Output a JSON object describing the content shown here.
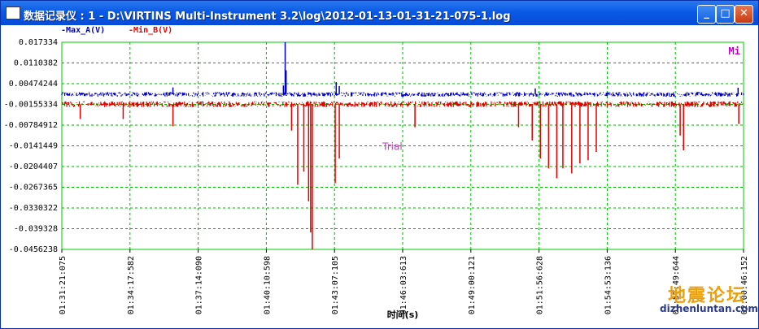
{
  "window": {
    "title": "数据记录仪 : 1 - D:\\VIRTINS Multi-Instrument 3.2\\log\\2012-01-13-01-31-21-075-1.log",
    "minimize_icon": "minimize-icon",
    "maximize_icon": "maximize-icon",
    "close_icon": "close-icon"
  },
  "chart_data": {
    "type": "line",
    "xlabel": "时间(s)",
    "ylabel": "",
    "title": "",
    "grid": true,
    "legend_position": "top-left",
    "watermark": "Trial",
    "corner_marker": "Mi",
    "yticks": [
      "0.017334",
      "0.0110382",
      "0.00474244",
      "-0.00155334",
      "-0.00784912",
      "-0.0141449",
      "-0.0204407",
      "-0.0267365",
      "-0.0330322",
      "-0.039328",
      "-0.0456238"
    ],
    "xticks": [
      "01:31:21:075",
      "01:34:17:582",
      "01:37:14:090",
      "01:40:10:598",
      "01:43:07:105",
      "01:46:03:613",
      "01:49:00:121",
      "01:51:56:628",
      "01:54:53:136",
      "01:57:49:644",
      "02:00:46:152"
    ],
    "ylim": [
      -0.0456238,
      0.017334
    ],
    "series": [
      {
        "name": "Max_A(V)",
        "color": "#0000c8",
        "baseline": 0.0015,
        "noise": 0.0007,
        "spikes": [
          {
            "x": 0.3276,
            "v": 0.017334
          },
          {
            "x": 0.329,
            "v": 0.0088
          },
          {
            "x": 0.325,
            "v": 0.0042
          },
          {
            "x": 0.4025,
            "v": 0.0052
          },
          {
            "x": 0.407,
            "v": 0.004
          },
          {
            "x": 0.163,
            "v": 0.0036
          },
          {
            "x": 0.992,
            "v": 0.0035
          },
          {
            "x": 0.6945,
            "v": 0.0033
          }
        ]
      },
      {
        "name": "Min_B(V)",
        "color": "#e00000",
        "baseline": -0.0015,
        "noise": 0.0009,
        "spikes": [
          {
            "x": 0.3674,
            "v": -0.0456238
          },
          {
            "x": 0.365,
            "v": -0.0405
          },
          {
            "x": 0.362,
            "v": -0.031
          },
          {
            "x": 0.346,
            "v": -0.026
          },
          {
            "x": 0.355,
            "v": -0.022
          },
          {
            "x": 0.337,
            "v": -0.0095
          },
          {
            "x": 0.401,
            "v": -0.0255
          },
          {
            "x": 0.407,
            "v": -0.018
          },
          {
            "x": 0.518,
            "v": -0.0085
          },
          {
            "x": 0.163,
            "v": -0.0082
          },
          {
            "x": 0.09,
            "v": -0.006
          },
          {
            "x": 0.69,
            "v": -0.0125
          },
          {
            "x": 0.702,
            "v": -0.018
          },
          {
            "x": 0.714,
            "v": -0.021
          },
          {
            "x": 0.726,
            "v": -0.024
          },
          {
            "x": 0.735,
            "v": -0.021
          },
          {
            "x": 0.748,
            "v": -0.0225
          },
          {
            "x": 0.76,
            "v": -0.0195
          },
          {
            "x": 0.772,
            "v": -0.0185
          },
          {
            "x": 0.784,
            "v": -0.016
          },
          {
            "x": 0.67,
            "v": -0.0085
          },
          {
            "x": 0.912,
            "v": -0.0155
          },
          {
            "x": 0.907,
            "v": -0.011
          },
          {
            "x": 0.993,
            "v": -0.0075
          },
          {
            "x": 0.027,
            "v": -0.006
          }
        ]
      }
    ]
  },
  "watermark_site": {
    "name_cn": "地震论坛",
    "url": "dizhenluntan.com"
  }
}
